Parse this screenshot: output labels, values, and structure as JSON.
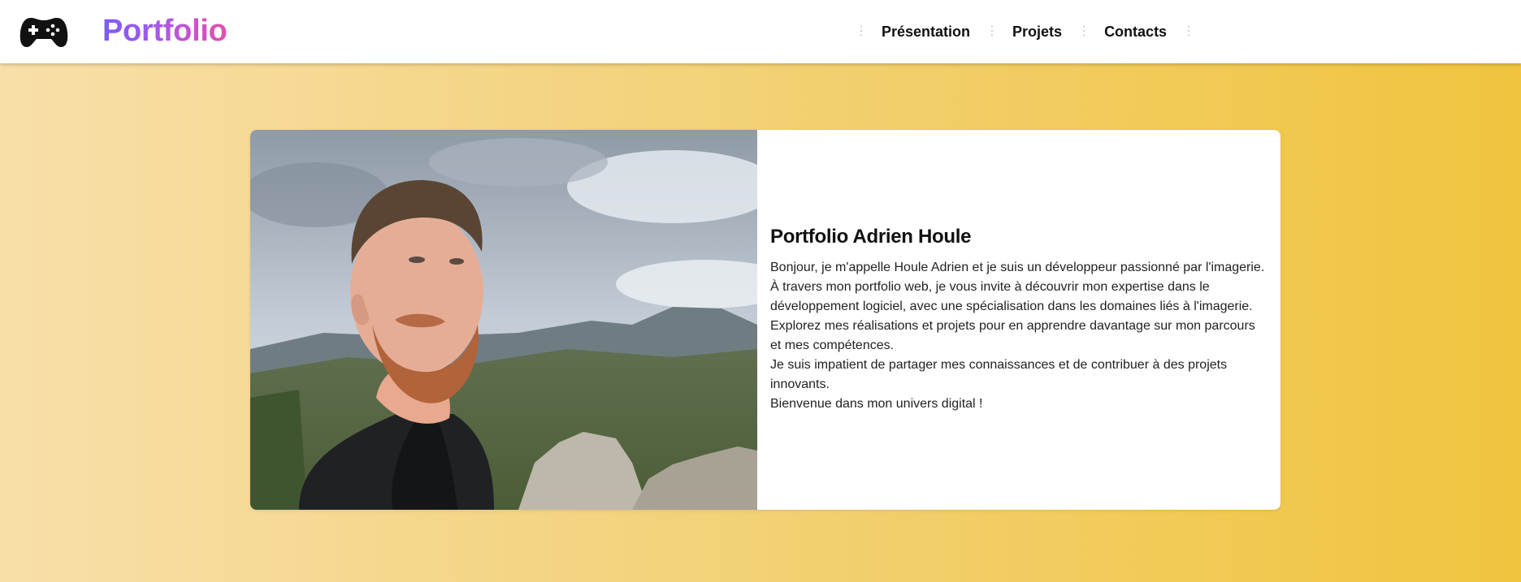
{
  "header": {
    "logo_icon": "gamepad-icon",
    "brand": "Portfolio",
    "nav": [
      "Présentation",
      "Projets",
      "Contacts"
    ]
  },
  "hero": {
    "photo_icon": "profile-photo",
    "title": "Portfolio Adrien Houle",
    "paragraphs": [
      "Bonjour, je m'appelle Houle Adrien et je suis un développeur passionné par l'imagerie. À travers mon portfolio web, je vous invite à découvrir mon expertise dans le développement logiciel, avec une spécialisation dans les domaines liés à l'imagerie. Explorez mes réalisations et projets pour en apprendre davantage sur mon parcours et mes compétences.",
      "Je suis impatient de partager mes connaissances et de contribuer à des projets innovants.",
      "Bienvenue dans mon univers digital !"
    ]
  },
  "colors": {
    "brand_gradient_start": "#7b5cf5",
    "brand_gradient_end": "#e54fae",
    "background_left": "#f8dfa9",
    "background_right": "#f0c43e"
  }
}
